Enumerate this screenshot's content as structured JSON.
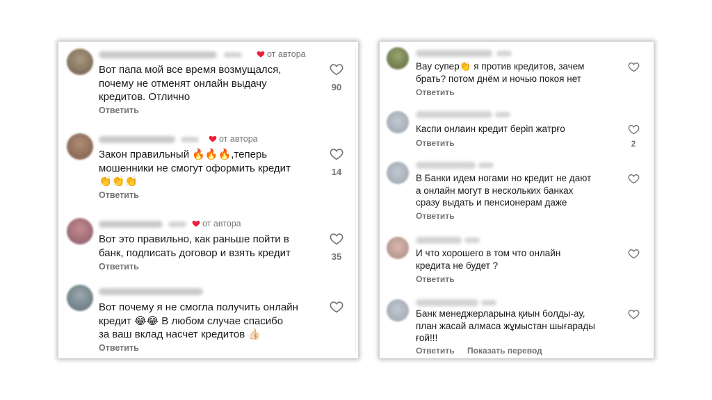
{
  "labels": {
    "from_author": "от автора",
    "reply": "Ответить",
    "translate": "Показать перевод"
  },
  "left_comments": [
    {
      "lines": [
        "Вот папа мой все время возмущался,",
        "почему не отменят онлайн выдачу",
        "кредитов. Отлично"
      ],
      "likes": "90",
      "author_liked": true
    },
    {
      "lines": [
        "Закон правильный 🔥🔥🔥,теперь",
        "мошенники не смогут оформить кредит",
        "👏👏👏"
      ],
      "likes": "14",
      "author_liked": true
    },
    {
      "lines": [
        "Вот это правильно, как раньше пойти в",
        "банк, подписать договор и взять кредит"
      ],
      "likes": "35",
      "author_liked": true
    },
    {
      "lines": [
        "Вот почему я не смогла получить онлайн",
        "кредит 😂😂 В любом случае спасибо",
        "за ваш вклад насчет кредитов 👍🏻"
      ],
      "likes": "",
      "author_liked": false
    }
  ],
  "right_comments": [
    {
      "lines": [
        "Вау супер👏 я против кредитов, зачем",
        "брать? потом днём и ночью покоя нет"
      ],
      "likes": ""
    },
    {
      "lines": [
        "Каспи онлаин кредит беріп жатрғо"
      ],
      "likes": "2"
    },
    {
      "lines": [
        "В Банки  идем ногами но кредит не дают",
        "а онлайн могут в нескольких банках",
        "сразу выдать и пенсионерам даже"
      ],
      "likes": ""
    },
    {
      "lines": [
        "И что хорошего в том что онлайн",
        "кредита не будет ?"
      ],
      "likes": ""
    },
    {
      "lines": [
        "Банк менеджерларына қиын болды-ау,",
        "план жасай алмаса жұмыстан шығарады",
        "ғой!!!"
      ],
      "likes": "",
      "show_translate": true
    }
  ],
  "colors": {
    "heart_red": "#ed1f3c",
    "muted_text": "#737373"
  },
  "icons": {
    "like": "heart-outline-icon",
    "author_like": "heart-filled-icon"
  }
}
